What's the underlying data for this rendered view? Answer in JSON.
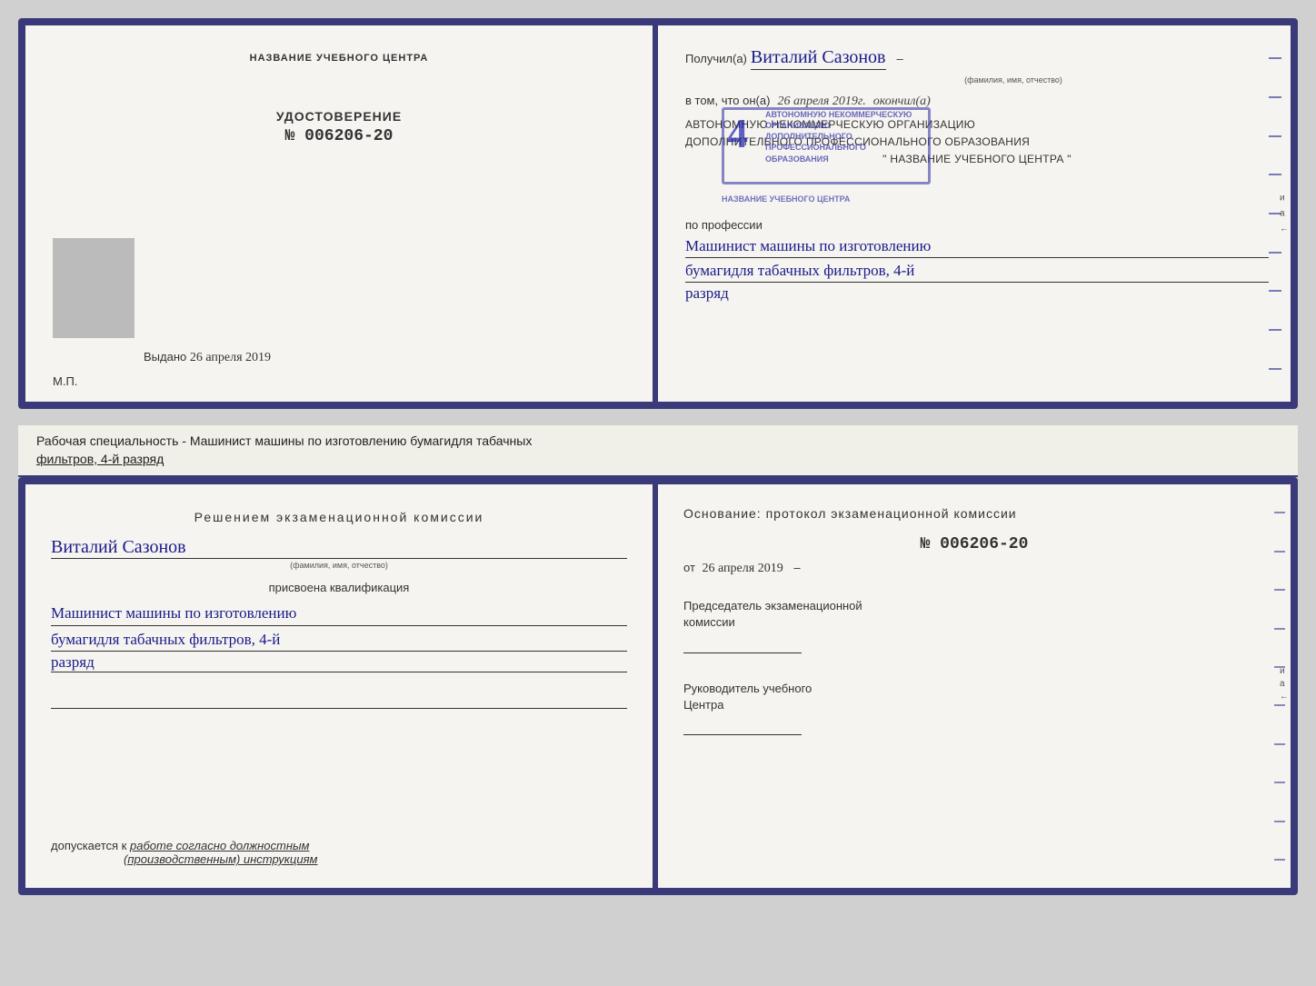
{
  "topLeft": {
    "institution_label": "НАЗВАНИЕ УЧЕБНОГО ЦЕНТРА",
    "doc_type": "УДОСТОВЕРЕНИЕ",
    "doc_number": "№ 006206-20",
    "issued_label": "Выдано",
    "issued_date": "26 апреля 2019",
    "mp_label": "М.П."
  },
  "topRight": {
    "poluchil_label": "Получил(а)",
    "name": "Виталий Сазонов",
    "name_hint": "(фамилия, имя, отчество)",
    "dash": "–",
    "vtom_label": "в том, что он(а)",
    "date_handwritten": "26 апреля 2019г.",
    "okonchil_label": "окончил(а)",
    "org_line1": "АВТОНОМНУЮ НЕКОММЕРЧЕСКУЮ ОРГАНИЗАЦИЮ",
    "org_line2": "ДОПОЛНИТЕЛЬНОГО ПРОФЕССИОНАЛЬНОГО ОБРАЗОВАНИЯ",
    "org_line3": "\" НАЗВАНИЕ УЧЕБНОГО ЦЕНТРА \"",
    "po_professii": "по профессии",
    "profession_line1": "Машинист машины по изготовлению",
    "profession_line2": "бумагидля табачных фильтров, 4-й",
    "profession_razryad": "разряд"
  },
  "middleText": {
    "main": "Рабочая специальность - Машинист машины по изготовлению бумагидля табачных",
    "underlined": "фильтров, 4-й разряд"
  },
  "bottomLeft": {
    "decision_title": "Решением  экзаменационной  комиссии",
    "name": "Виталий  Сазонов",
    "name_hint": "(фамилия, имя, отчество)",
    "prisvoena": "присвоена квалификация",
    "qual_line1": "Машинист машины по изготовлению",
    "qual_line2": "бумагидля табачных фильтров, 4-й",
    "qual_line3": "разряд",
    "dopuskaetsya_label": "допускается к",
    "dopuskaetsya_value": "работе согласно должностным",
    "dopuskaetsya_value2": "(производственным) инструкциям"
  },
  "bottomRight": {
    "osnovaniye": "Основание:  протокол  экзаменационной  комиссии",
    "number": "№  006206-20",
    "ot_label": "от",
    "ot_date": "26 апреля 2019",
    "predsedatel_label": "Председатель экзаменационной",
    "komissii_label": "комиссии",
    "rukovoditel_line1": "Руководитель учебного",
    "rukovoditel_line2": "Центра"
  },
  "edgeLabels": [
    "и",
    "а",
    "←"
  ],
  "stamp": {
    "number": "4",
    "line1": "АВТОНОМНУЮ НЕКОММЕРЧЕСКУЮ",
    "line2": "ОРГАНИЗАЦИЮ",
    "line3": "ДОПОЛНИТЕЛЬНОГО",
    "line4": "ПРОФЕССИОНАЛЬНОГО",
    "line5": "ОБРАЗОВАНИЯ"
  }
}
